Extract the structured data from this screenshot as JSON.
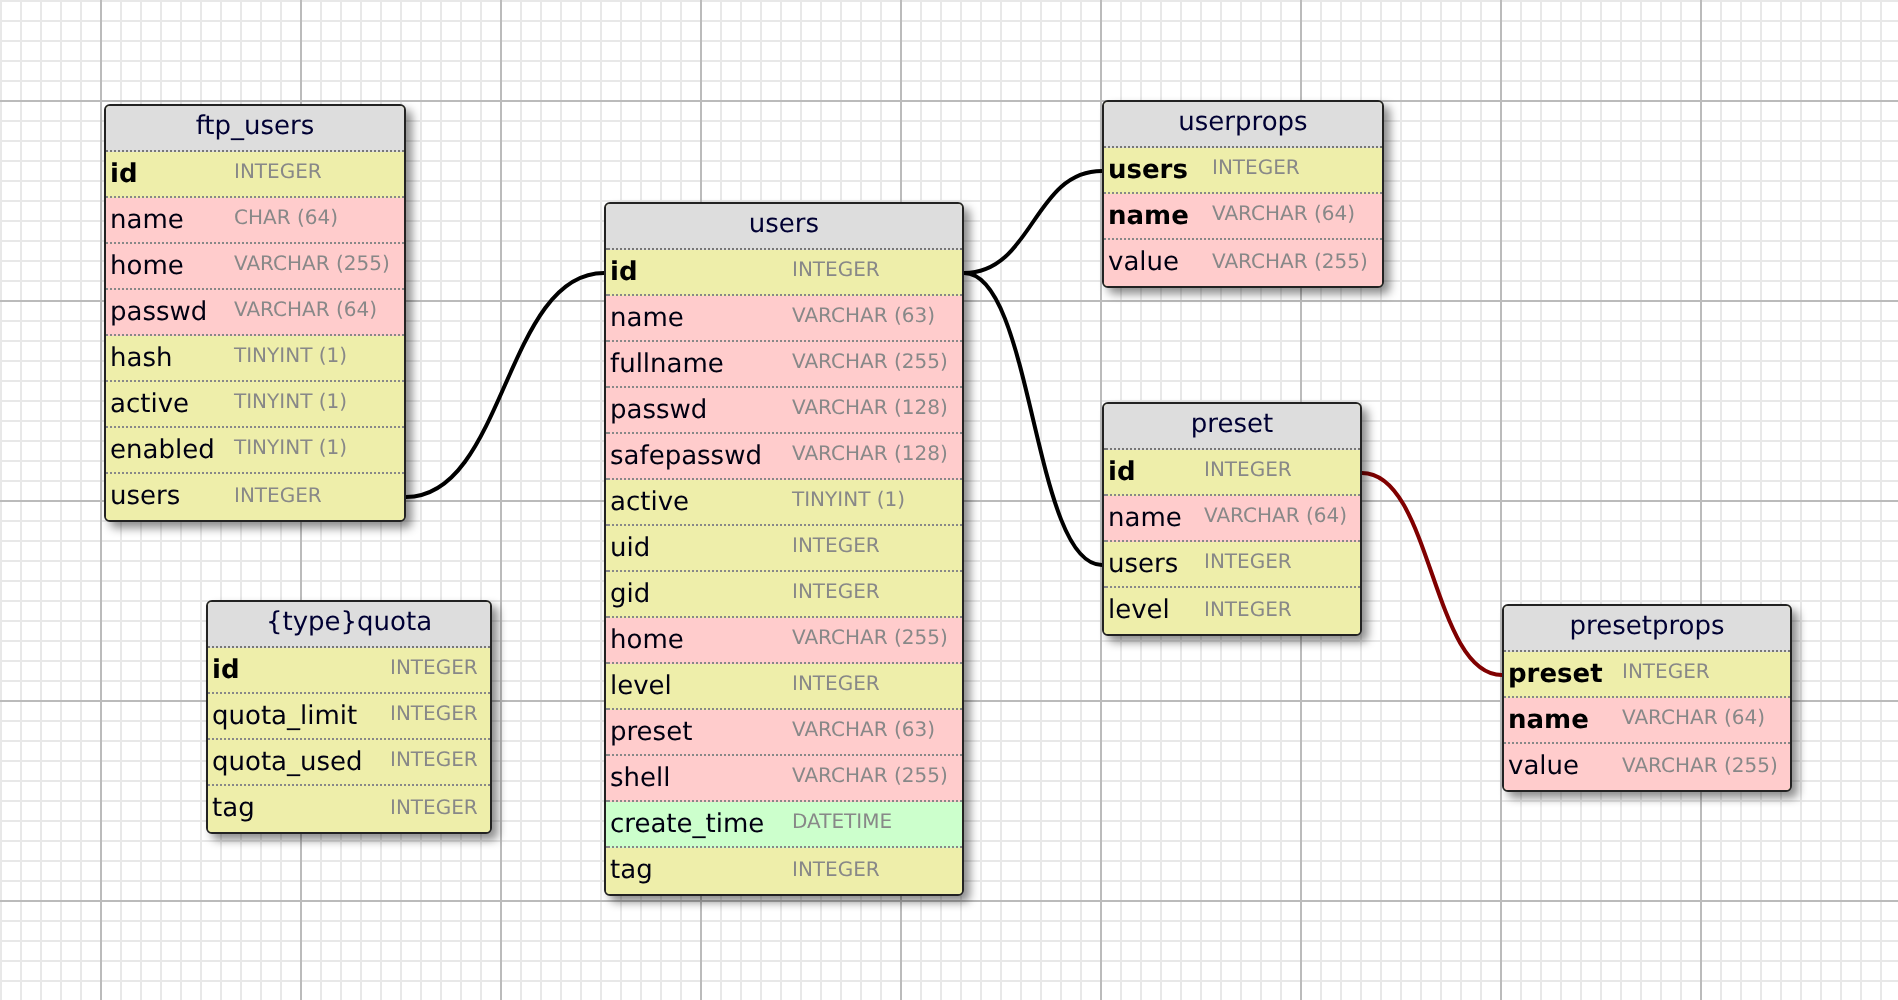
{
  "tables": [
    {
      "title": "ftp_users",
      "fields": [
        {
          "name": "id",
          "type": "INTEGER",
          "primary": true,
          "color": "#eeeeaa"
        },
        {
          "name": "name",
          "type": "CHAR (64)",
          "primary": false,
          "color": "#ffcccc"
        },
        {
          "name": "home",
          "type": "VARCHAR (255)",
          "primary": false,
          "color": "#ffcccc"
        },
        {
          "name": "passwd",
          "type": "VARCHAR (64)",
          "primary": false,
          "color": "#ffcccc"
        },
        {
          "name": "hash",
          "type": "TINYINT (1)",
          "primary": false,
          "color": "#eeeeaa"
        },
        {
          "name": "active",
          "type": "TINYINT (1)",
          "primary": false,
          "color": "#eeeeaa"
        },
        {
          "name": "enabled",
          "type": "TINYINT (1)",
          "primary": false,
          "color": "#eeeeaa"
        },
        {
          "name": "users",
          "type": "INTEGER",
          "primary": false,
          "color": "#eeeeaa"
        }
      ]
    },
    {
      "title": "users",
      "fields": [
        {
          "name": "id",
          "type": "INTEGER",
          "primary": true,
          "color": "#eeeeaa"
        },
        {
          "name": "name",
          "type": "VARCHAR (63)",
          "primary": false,
          "color": "#ffcccc"
        },
        {
          "name": "fullname",
          "type": "VARCHAR (255)",
          "primary": false,
          "color": "#ffcccc"
        },
        {
          "name": "passwd",
          "type": "VARCHAR (128)",
          "primary": false,
          "color": "#ffcccc"
        },
        {
          "name": "safepasswd",
          "type": "VARCHAR (128)",
          "primary": false,
          "color": "#ffcccc"
        },
        {
          "name": "active",
          "type": "TINYINT (1)",
          "primary": false,
          "color": "#eeeeaa"
        },
        {
          "name": "uid",
          "type": "INTEGER",
          "primary": false,
          "color": "#eeeeaa"
        },
        {
          "name": "gid",
          "type": "INTEGER",
          "primary": false,
          "color": "#eeeeaa"
        },
        {
          "name": "home",
          "type": "VARCHAR (255)",
          "primary": false,
          "color": "#ffcccc"
        },
        {
          "name": "level",
          "type": "INTEGER",
          "primary": false,
          "color": "#eeeeaa"
        },
        {
          "name": "preset",
          "type": "VARCHAR (63)",
          "primary": false,
          "color": "#ffcccc"
        },
        {
          "name": "shell",
          "type": "VARCHAR (255)",
          "primary": false,
          "color": "#ffcccc"
        },
        {
          "name": "create_time",
          "type": "DATETIME",
          "primary": false,
          "color": "#ccffcc"
        },
        {
          "name": "tag",
          "type": "INTEGER",
          "primary": false,
          "color": "#eeeeaa"
        }
      ]
    },
    {
      "title": "userprops",
      "fields": [
        {
          "name": "users",
          "type": "INTEGER",
          "primary": true,
          "color": "#eeeeaa"
        },
        {
          "name": "name",
          "type": "VARCHAR (64)",
          "primary": true,
          "color": "#ffcccc"
        },
        {
          "name": "value",
          "type": "VARCHAR (255)",
          "primary": false,
          "color": "#ffcccc"
        }
      ]
    },
    {
      "title": "preset",
      "fields": [
        {
          "name": "id",
          "type": "INTEGER",
          "primary": true,
          "color": "#eeeeaa"
        },
        {
          "name": "name",
          "type": "VARCHAR (64)",
          "primary": false,
          "color": "#ffcccc"
        },
        {
          "name": "users",
          "type": "INTEGER",
          "primary": false,
          "color": "#eeeeaa"
        },
        {
          "name": "level",
          "type": "INTEGER",
          "primary": false,
          "color": "#eeeeaa"
        }
      ]
    },
    {
      "title": "{type}quota",
      "fields": [
        {
          "name": "id",
          "type": "INTEGER",
          "primary": true,
          "color": "#eeeeaa"
        },
        {
          "name": "quota_limit",
          "type": "INTEGER",
          "primary": false,
          "color": "#eeeeaa"
        },
        {
          "name": "quota_used",
          "type": "INTEGER",
          "primary": false,
          "color": "#eeeeaa"
        },
        {
          "name": "tag",
          "type": "INTEGER",
          "primary": false,
          "color": "#eeeeaa"
        }
      ]
    },
    {
      "title": "presetprops",
      "fields": [
        {
          "name": "preset",
          "type": "INTEGER",
          "primary": true,
          "color": "#eeeeaa"
        },
        {
          "name": "name",
          "type": "VARCHAR (64)",
          "primary": true,
          "color": "#ffcccc"
        },
        {
          "name": "value",
          "type": "VARCHAR (255)",
          "primary": false,
          "color": "#ffcccc"
        }
      ]
    }
  ],
  "relations": [
    {
      "color": "#000000"
    },
    {
      "color": "#000000"
    },
    {
      "color": "#000000"
    },
    {
      "color": "#800000"
    }
  ]
}
